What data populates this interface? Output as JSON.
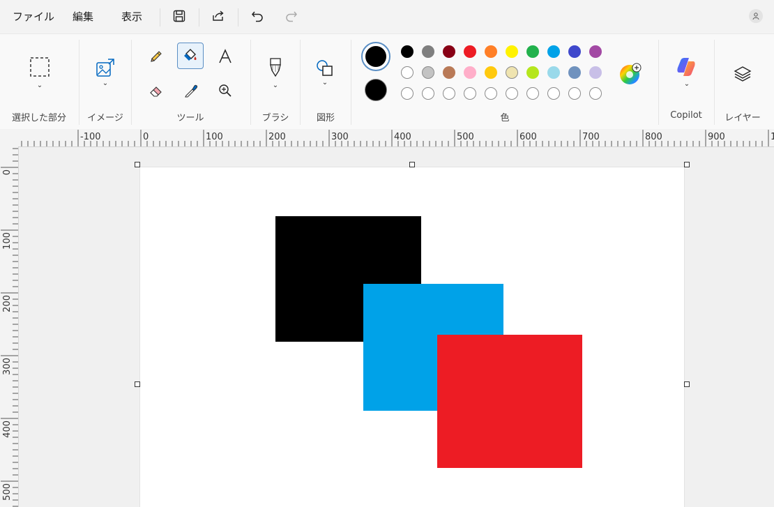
{
  "menu": {
    "file": "ファイル",
    "edit": "編集",
    "view": "表示"
  },
  "quick_access": {
    "save_icon": "save-icon",
    "share_icon": "share-icon",
    "undo_icon": "undo-icon",
    "redo_icon": "redo-icon"
  },
  "ribbon": {
    "selection_label": "選択した部分",
    "image_label": "イメージ",
    "tools_label": "ツール",
    "brush_label": "ブラシ",
    "shapes_label": "図形",
    "colors_label": "色",
    "copilot_label": "Copilot",
    "layers_label": "レイヤー"
  },
  "colors": {
    "primary": "#000000",
    "secondary": "#000000",
    "row1": [
      "#000000",
      "#7f7f7f",
      "#880015",
      "#ed1c24",
      "#ff7f27",
      "#fff200",
      "#22b14c",
      "#00a2e8",
      "#3f48cc",
      "#a349a4"
    ],
    "row2": [
      "#ffffff",
      "#c3c3c3",
      "#b97a57",
      "#ffaec9",
      "#ffc90e",
      "#efe4b0",
      "#b5e61d",
      "#99d9ea",
      "#7092be",
      "#c8bfe7"
    ],
    "row3": [
      "",
      "",
      "",
      "",
      "",
      "",
      "",
      "",
      "",
      ""
    ]
  },
  "ruler": {
    "top": [
      "-100",
      "0",
      "100",
      "200",
      "300",
      "400",
      "500",
      "600",
      "700",
      "800",
      "900",
      "1"
    ],
    "left": [
      "0",
      "100",
      "200",
      "300",
      "400",
      "500"
    ]
  },
  "canvas": {
    "shapes": [
      {
        "name": "black-rectangle",
        "color": "#000000"
      },
      {
        "name": "blue-rectangle",
        "color": "#00a2e8"
      },
      {
        "name": "red-rectangle",
        "color": "#ed1c24"
      }
    ]
  }
}
